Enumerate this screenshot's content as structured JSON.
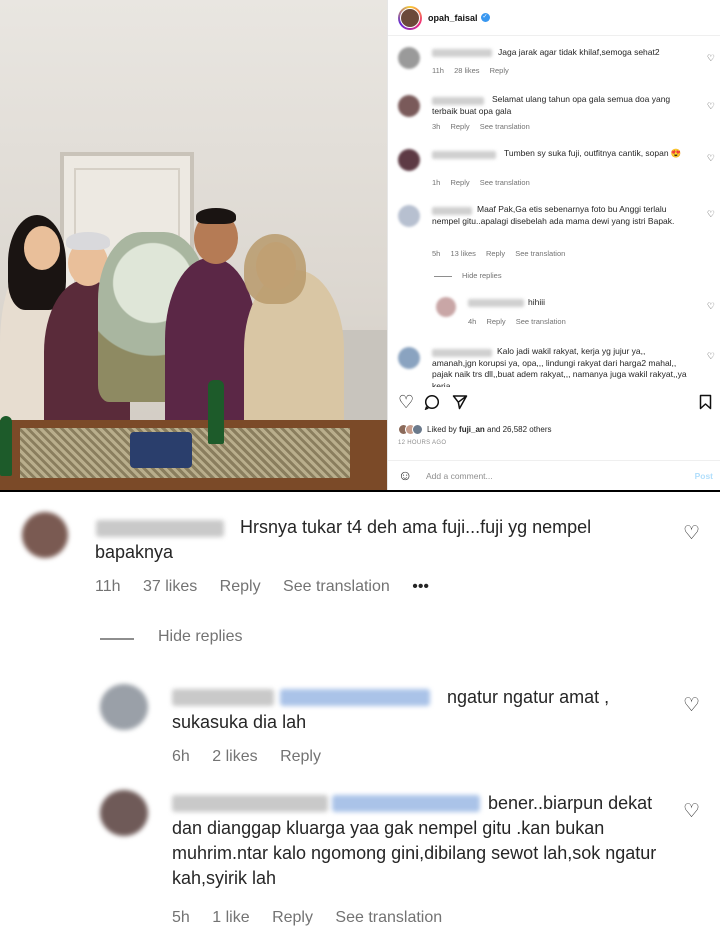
{
  "post": {
    "username": "opah_faisal",
    "comments": [
      {
        "text": "Jaga jarak agar tidak khilaf,semoga sehat2",
        "time": "11h",
        "likes": "28 likes",
        "reply": "Reply"
      },
      {
        "text": "Selamat ulang tahun opa gala semua doa yang terbaik buat opa gala",
        "time": "3h",
        "reply": "Reply",
        "translate": "See translation"
      },
      {
        "text": "Tumben sy suka fuji, outfitnya cantik, sopan 😍",
        "time": "1h",
        "reply": "Reply",
        "translate": "See translation"
      },
      {
        "text": "Maaf Pak,Ga etis sebenarnya foto bu Anggi terlalu nempel gitu..apalagi disebelah ada mama dewi yang istri Bapak.",
        "time": "5h",
        "likes": "13 likes",
        "reply": "Reply",
        "translate": "See translation"
      },
      {
        "text": "hihiii",
        "time": "4h",
        "reply": "Reply",
        "translate": "See translation"
      },
      {
        "text": "Kalo jadi wakil rakyat, kerja yg jujur ya,, amanah,jgn korupsi ya, opa,,, lindungi rakyat dari harga2 mahal,, pajak naik trs dll,,buat adem rakyat,,, namanya juga wakil rakyat,,ya kerja"
      }
    ],
    "hide_replies": "Hide replies",
    "liked_by_prefix": "Liked by ",
    "liked_by_user": "fuji_an",
    "liked_by_suffix": " and 26,582 others",
    "ago": "12 HOURS AGO",
    "add_comment_placeholder": "Add a comment...",
    "post_label": "Post"
  },
  "zoom": {
    "comment1": {
      "text": "Hrsnya tukar t4 deh ama fuji...fuji yg nempel bapaknya",
      "time": "11h",
      "likes": "37 likes",
      "reply": "Reply",
      "translate": "See translation",
      "more": "•••"
    },
    "hide_replies": "Hide replies",
    "reply1": {
      "text": "ngatur ngatur amat , sukasuka dia lah",
      "time": "6h",
      "likes": "2 likes",
      "reply": "Reply"
    },
    "reply2": {
      "text": "bener..biarpun dekat dan dianggap kluarga yaa gak nempel gitu .kan bukan muhrim.ntar kalo ngomong gini,dibilang sewot lah,sok ngatur kah,syirik lah",
      "time": "5h",
      "likes": "1 like",
      "reply": "Reply",
      "translate": "See translation"
    }
  },
  "icons": {
    "heart": "♡",
    "comment": "comment-icon",
    "share": "share-icon",
    "save": "bookmark-icon",
    "emoji": "☺"
  },
  "colors": {
    "link_blue": "#3897f0",
    "post_disabled": "#b2dffc",
    "meta_gray": "#737373"
  }
}
